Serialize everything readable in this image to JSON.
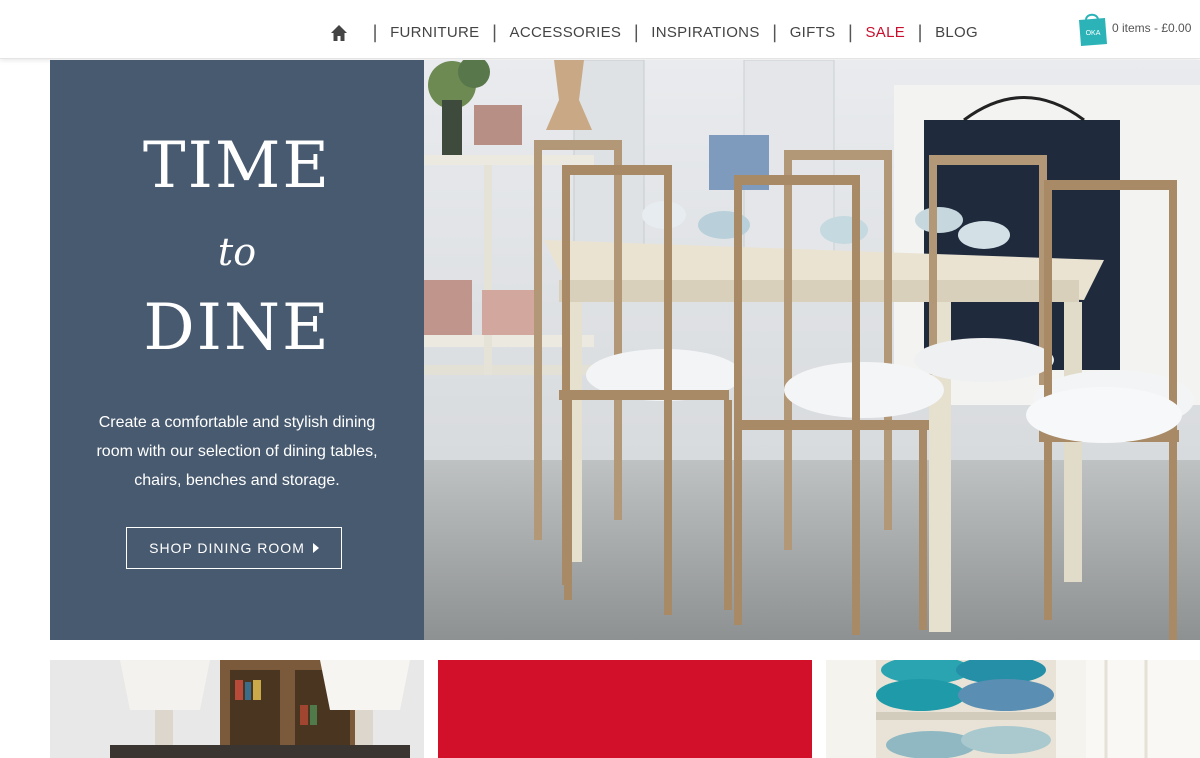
{
  "nav": {
    "home_icon": "home-icon",
    "items": [
      {
        "label": "FURNITURE"
      },
      {
        "label": "ACCESSORIES"
      },
      {
        "label": "INSPIRATIONS"
      },
      {
        "label": "GIFTS"
      },
      {
        "label": "SALE",
        "highlight": "#c8102e"
      },
      {
        "label": "BLOG"
      }
    ],
    "separator": "|"
  },
  "cart": {
    "bag_label": "OKA",
    "text": "0 items - £0.00",
    "bag_color": "#2bb3b8"
  },
  "hero": {
    "title_line1": "TIME",
    "title_line2": "to",
    "title_line3": "DINE",
    "description": "Create a comfortable and stylish dining room with our selection of dining tables, chairs, benches and storage.",
    "button_label": "SHOP DINING ROOM",
    "panel_color": "#485a70"
  },
  "tiles": [
    {
      "name": "lamps-bookcase"
    },
    {
      "name": "red-promo",
      "color": "#d3102a"
    },
    {
      "name": "cushions-shelves"
    }
  ]
}
